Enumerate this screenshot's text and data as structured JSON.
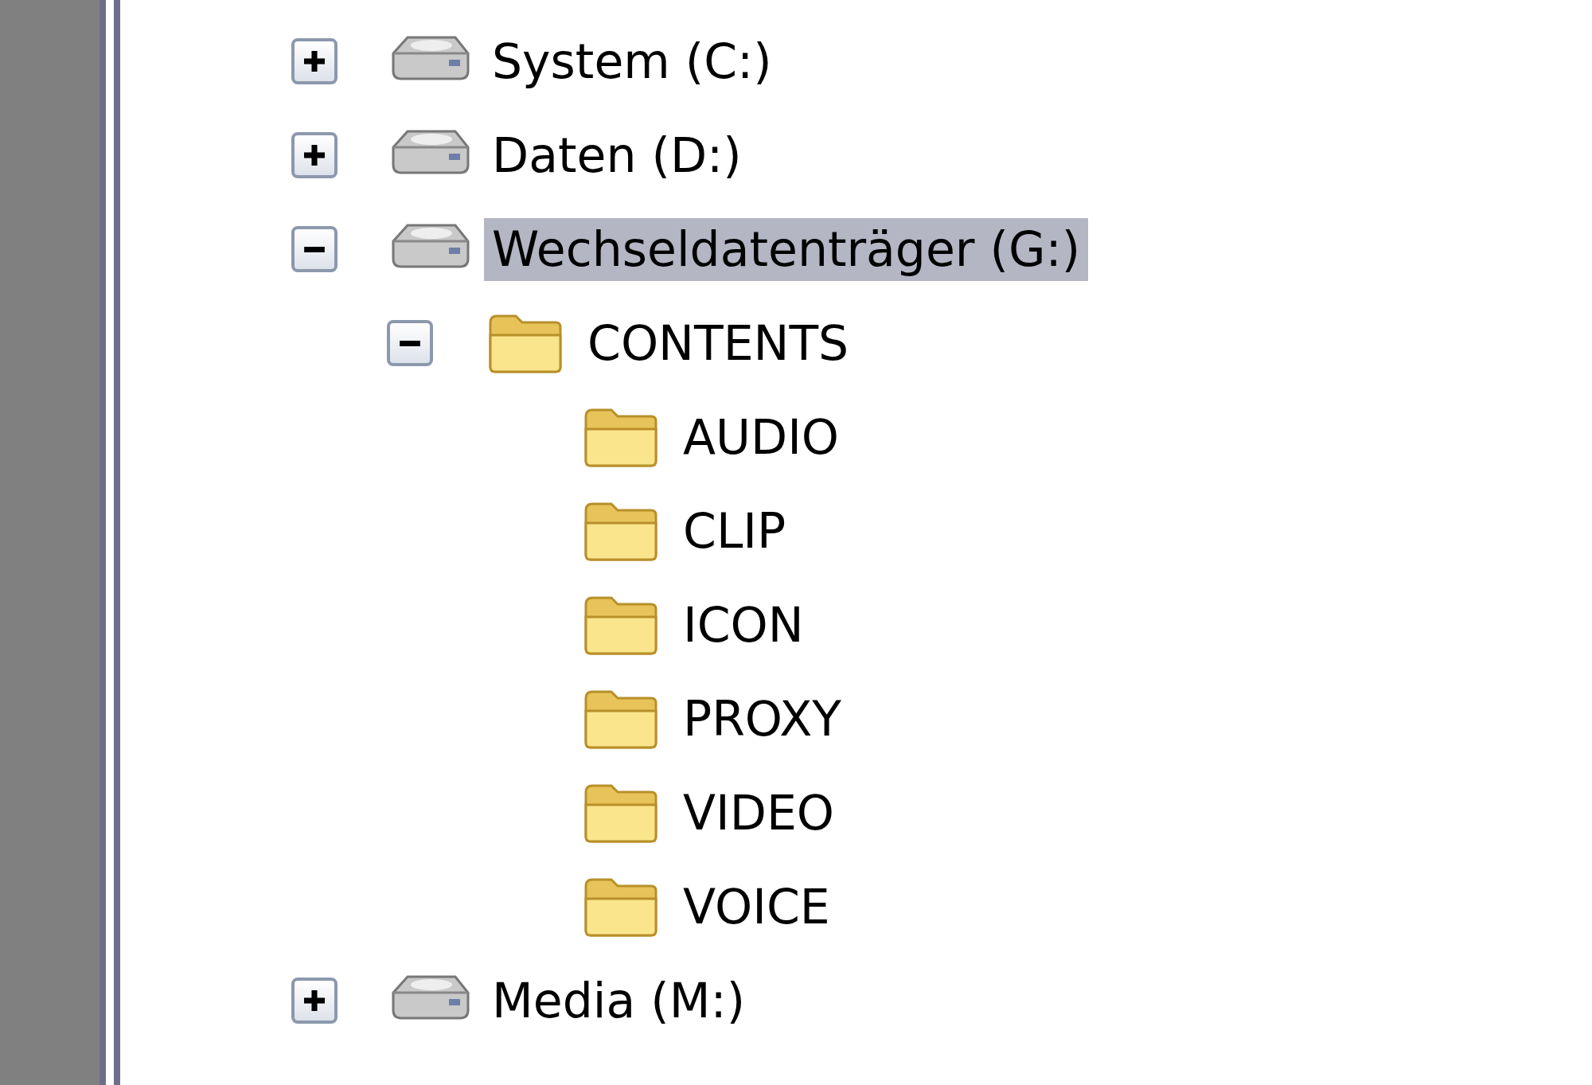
{
  "tree": [
    {
      "kind": "drive",
      "label": "System (C:)",
      "expanded": false,
      "selected": false
    },
    {
      "kind": "drive",
      "label": "Daten (D:)",
      "expanded": false,
      "selected": false
    },
    {
      "kind": "drive",
      "label": "Wechseldatenträger (G:)",
      "expanded": true,
      "selected": true,
      "children": [
        {
          "kind": "folder",
          "label": "CONTENTS",
          "expanded": true,
          "selected": false,
          "children": [
            {
              "kind": "folder",
              "label": "AUDIO",
              "selected": false
            },
            {
              "kind": "folder",
              "label": "CLIP",
              "selected": false
            },
            {
              "kind": "folder",
              "label": "ICON",
              "selected": false
            },
            {
              "kind": "folder",
              "label": "PROXY",
              "selected": false
            },
            {
              "kind": "folder",
              "label": "VIDEO",
              "selected": false
            },
            {
              "kind": "folder",
              "label": "VOICE",
              "selected": false
            }
          ]
        }
      ]
    },
    {
      "kind": "drive",
      "label": "Media (M:)",
      "expanded": false,
      "selected": false
    }
  ]
}
